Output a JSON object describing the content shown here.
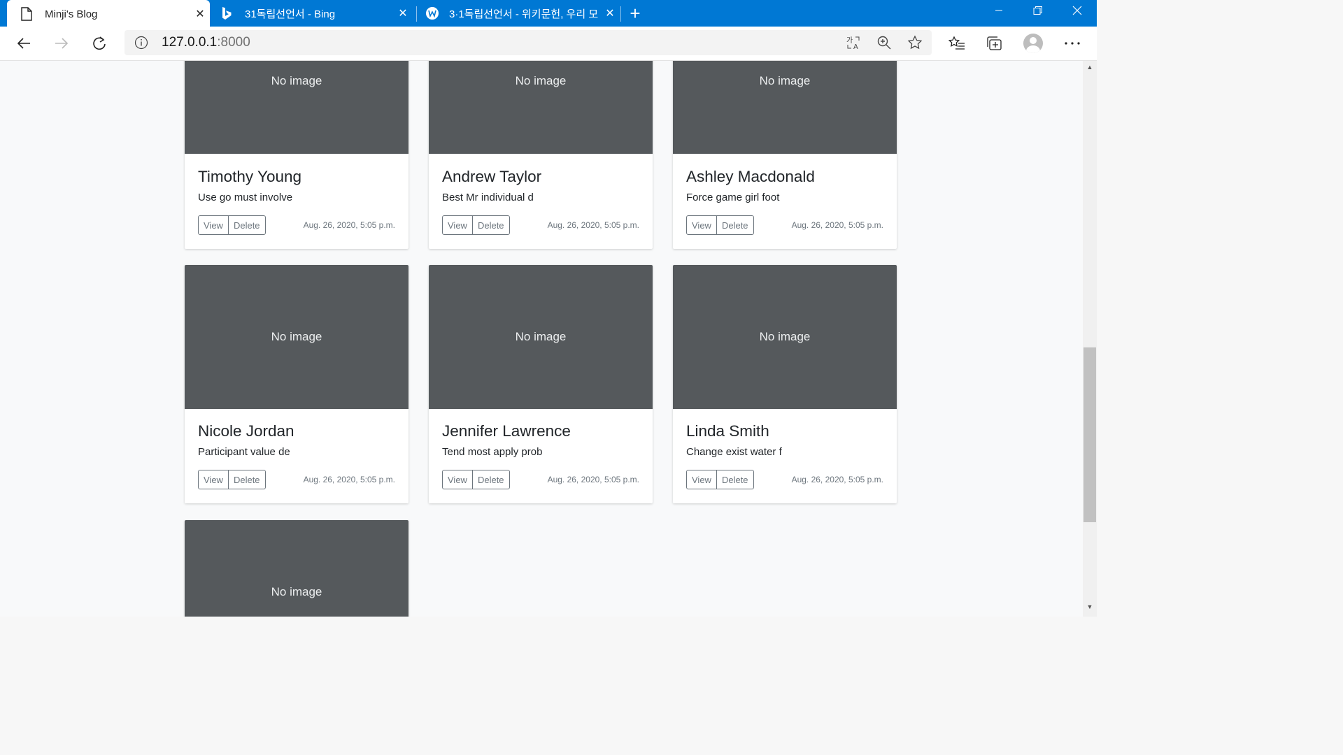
{
  "browser": {
    "tabs": [
      {
        "title": "Minji's Blog",
        "icon": "page-icon",
        "active": true
      },
      {
        "title": "31독립선언서 - Bing",
        "icon": "bing-icon",
        "active": false
      },
      {
        "title": "3·1독립선언서 - 위키문헌, 우리 모",
        "icon": "wikisource-icon",
        "active": false
      }
    ],
    "close_glyph": "✕",
    "newtab_glyph": "+",
    "url_host": "127.0.0.1",
    "url_port": ":8000",
    "accent": "#0078d4"
  },
  "posts": [
    {
      "title": "Timothy Young",
      "excerpt": "Use go must involve",
      "date": "Aug. 26, 2020, 5:05 p.m.",
      "image": "No image"
    },
    {
      "title": "Andrew Taylor",
      "excerpt": "Best Mr individual d",
      "date": "Aug. 26, 2020, 5:05 p.m.",
      "image": "No image"
    },
    {
      "title": "Ashley Macdonald",
      "excerpt": "Force game girl foot",
      "date": "Aug. 26, 2020, 5:05 p.m.",
      "image": "No image"
    },
    {
      "title": "Nicole Jordan",
      "excerpt": "Participant value de",
      "date": "Aug. 26, 2020, 5:05 p.m.",
      "image": "No image"
    },
    {
      "title": "Jennifer Lawrence",
      "excerpt": "Tend most apply prob",
      "date": "Aug. 26, 2020, 5:05 p.m.",
      "image": "No image"
    },
    {
      "title": "Linda Smith",
      "excerpt": "Change exist water f",
      "date": "Aug. 26, 2020, 5:05 p.m.",
      "image": "No image"
    },
    {
      "image": "No image"
    }
  ],
  "buttons": {
    "view": "View",
    "delete": "Delete"
  },
  "colors": {
    "thumb_bg": "#55595c",
    "card_bg": "#ffffff",
    "page_bg": "#f8f9fa"
  }
}
